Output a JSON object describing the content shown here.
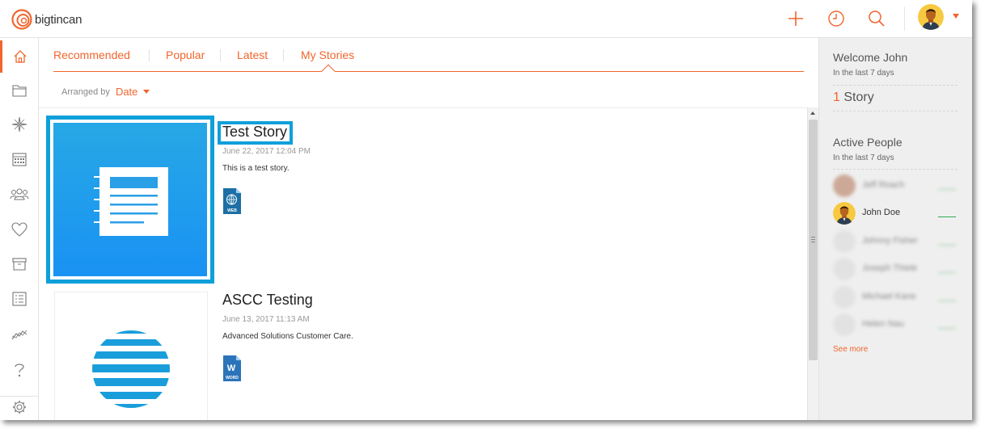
{
  "app": {
    "logo_text": "bigtincan",
    "brand_color": "#f0662e",
    "accent_blue": "#0fa0da"
  },
  "topbar": {
    "icons": [
      "plus-icon",
      "clock-icon",
      "search-icon",
      "avatar",
      "chevron-down-icon"
    ]
  },
  "leftnav": {
    "items": [
      "home-icon",
      "folder-icon",
      "compass-icon",
      "calendar-icon",
      "people-icon",
      "heart-icon",
      "archive-icon",
      "checklist-icon",
      "chart-icon",
      "help-icon",
      "settings-icon"
    ],
    "active": "home-icon"
  },
  "tabs": [
    {
      "label": "Recommended"
    },
    {
      "label": "Popular"
    },
    {
      "label": "Latest"
    },
    {
      "label": "My Stories"
    }
  ],
  "active_tab": "My Stories",
  "sort": {
    "label": "Arranged by",
    "value": "Date"
  },
  "stories": [
    {
      "title": "Test Story",
      "date": "June 22, 2017 12:04 PM",
      "description": "This is a test story.",
      "file_type": "WEB"
    },
    {
      "title": "ASCC Testing",
      "date": "June 13, 2017 11:13 AM",
      "description": "Advanced Solutions Customer Care.",
      "file_type": "WORD"
    }
  ],
  "right_panel": {
    "welcome": "Welcome John",
    "welcome_sub": "In the last 7 days",
    "story_count": "1",
    "story_label": "Story",
    "active_people_title": "Active People",
    "active_people_sub": "In the last 7 days",
    "people": [
      {
        "name": "Jeff Roach",
        "blurred": true
      },
      {
        "name": "John Doe",
        "blurred": false
      },
      {
        "name": "Johnny Fisher",
        "blurred": true
      },
      {
        "name": "Joseph Thiele",
        "blurred": true
      },
      {
        "name": "Michael Kane",
        "blurred": true
      },
      {
        "name": "Helen Nau",
        "blurred": true
      }
    ],
    "see_more": "See more"
  }
}
